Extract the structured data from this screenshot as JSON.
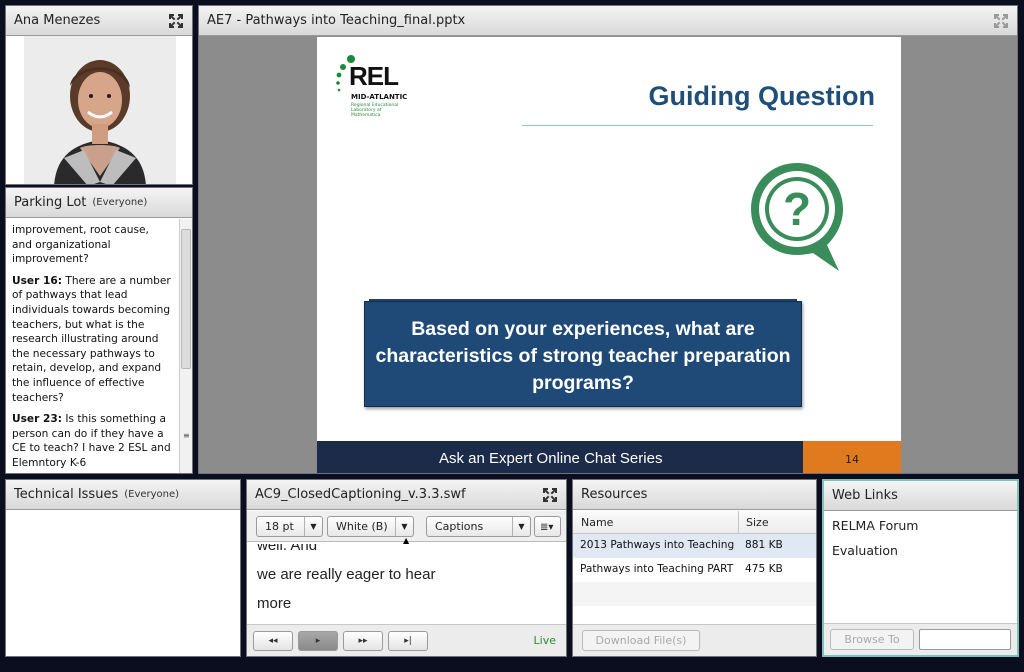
{
  "video_pod": {
    "title": "Ana Menezes"
  },
  "parking_lot": {
    "title": "Parking Lot",
    "audience": "(Everyone)",
    "messages": [
      {
        "user": "",
        "text": "improvement, root cause, and organizational improvement?"
      },
      {
        "user": "User 16:",
        "text": "There are a number of pathways that lead individuals towards becoming teachers, but what is the research illustrating around the necessary pathways to retain, develop, and expand the influence of effective teachers?"
      },
      {
        "user": "User 23:",
        "text": "Is this something a person can do if they have a CE to teach? I have 2 ESL and Elemntory K-6"
      }
    ]
  },
  "share_pod": {
    "title": "AE7 - Pathways into Teaching_final.pptx",
    "slide": {
      "logo_text": "REL",
      "logo_sub": "MID-ATLANTIC",
      "logo_tiny": "Regional Educational Laboratory at Mathematica",
      "title": "Guiding Question",
      "question": "Based on your experiences, what are characteristics of strong teacher preparation programs?",
      "footer": "Ask an Expert Online Chat Series",
      "page": "14",
      "accent_color": "#1f4a78",
      "footer_accent": "#e07a1f"
    }
  },
  "tech_pod": {
    "title": "Technical Issues",
    "audience": "(Everyone)"
  },
  "caption_pod": {
    "title": "AC9_ClosedCaptioning_v.3.3.swf",
    "font_size": "18 pt",
    "color": "White (B)",
    "mode": "Captions",
    "lines": [
      "well.  And",
      "we are really eager to hear",
      "more"
    ],
    "status": "Live"
  },
  "resources_pod": {
    "title": "Resources",
    "columns": [
      "Name",
      "Size"
    ],
    "rows": [
      {
        "name": "2013 Pathways into Teaching",
        "size": "881 KB"
      },
      {
        "name": "Pathways into Teaching PART",
        "size": "475 KB"
      }
    ],
    "download_label": "Download File(s)"
  },
  "links_pod": {
    "title": "Web Links",
    "links": [
      "RELMA Forum",
      "Evaluation"
    ],
    "browse_label": "Browse To"
  }
}
